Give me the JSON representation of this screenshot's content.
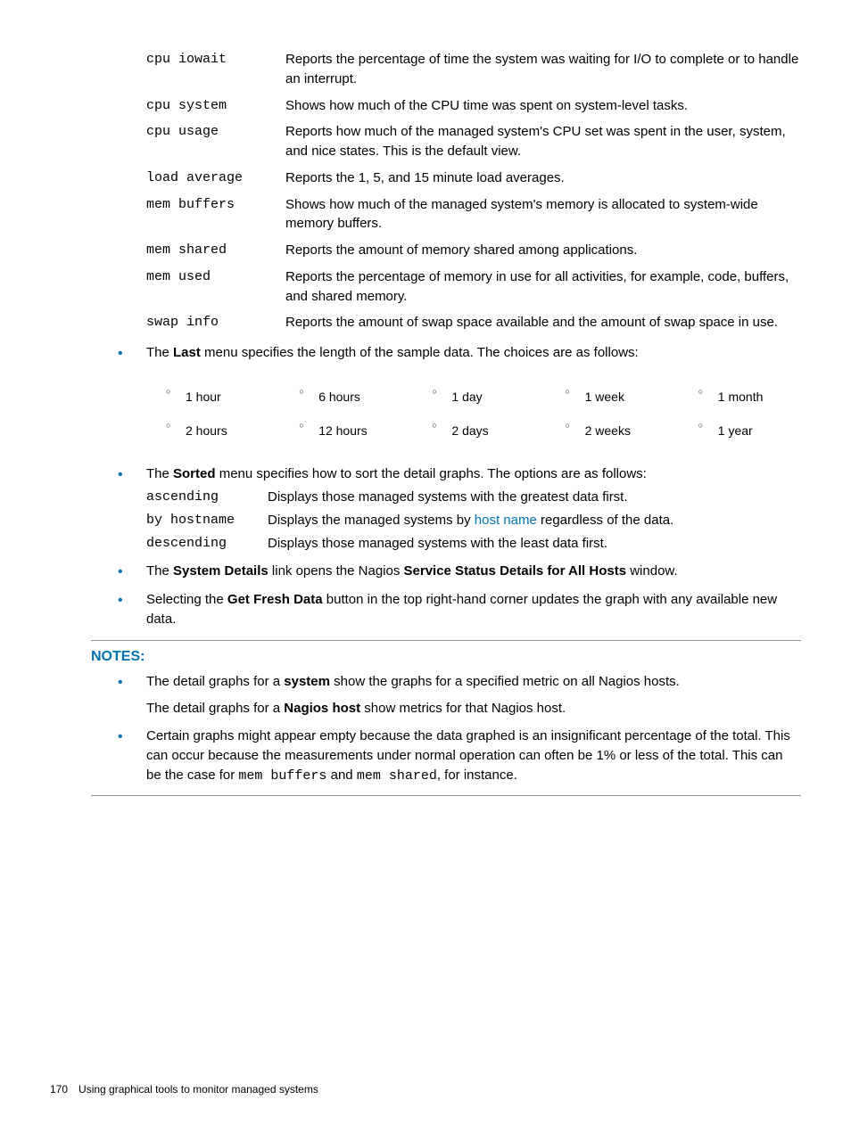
{
  "metrics": [
    {
      "term": "cpu iowait",
      "desc": "Reports the percentage of time the system was waiting for I/O to complete or to handle an interrupt."
    },
    {
      "term": "cpu system",
      "desc": "Shows how much of the CPU time was spent on system-level tasks."
    },
    {
      "term": "cpu usage",
      "desc": "Reports how much of the managed system's CPU set was spent in the user, system, and nice states. This is the default view."
    },
    {
      "term": "load average",
      "desc": "Reports the 1, 5, and 15 minute load averages."
    },
    {
      "term": "mem buffers",
      "desc": "Shows how much of the managed system's memory is allocated to system-wide memory buffers."
    },
    {
      "term": "mem shared",
      "desc": "Reports the amount of memory shared among applications."
    },
    {
      "term": "mem used",
      "desc": "Reports the percentage of memory in use for all activities, for example, code, buffers, and shared memory."
    },
    {
      "term": "swap info",
      "desc": "Reports the amount of swap space available and the amount of swap space in use."
    }
  ],
  "last_menu": {
    "intro_pre": "The ",
    "intro_bold": "Last",
    "intro_post": " menu specifies the length of the sample data. The choices are as follows:",
    "options": [
      "1 hour",
      "6 hours",
      "1 day",
      "1 week",
      "1 month",
      "2 hours",
      "12 hours",
      "2 days",
      "2 weeks",
      "1 year"
    ]
  },
  "sorted_menu": {
    "intro_pre": "The ",
    "intro_bold": "Sorted",
    "intro_post": " menu specifies how to sort the detail graphs. The options are as follows:",
    "rows": [
      {
        "term": "ascending",
        "desc_pre": "Displays those managed systems with the greatest data first.",
        "link": "",
        "desc_post": ""
      },
      {
        "term": "by hostname",
        "desc_pre": "Displays the managed systems by ",
        "link": "host name",
        "desc_post": " regardless of the data."
      },
      {
        "term": "descending",
        "desc_pre": "Displays those managed systems with the least data first.",
        "link": "",
        "desc_post": ""
      }
    ]
  },
  "system_details": {
    "pre": "The ",
    "b1": "System Details",
    "mid": " link opens the Nagios ",
    "b2": "Service Status Details for All Hosts",
    "post": " window."
  },
  "fresh_data": {
    "pre": "Selecting the ",
    "b1": "Get Fresh Data",
    "post": " button in the top right-hand corner updates the graph with any available new data."
  },
  "notes": {
    "heading": "NOTES:",
    "item1_line1_pre": "The detail graphs for a ",
    "item1_line1_b": "system",
    "item1_line1_post": " show the graphs for a specified metric on all Nagios hosts.",
    "item1_line2_pre": "The detail graphs for a ",
    "item1_line2_b": "Nagios host",
    "item1_line2_post": " show metrics for that Nagios host.",
    "item2_pre": "Certain graphs might appear empty because the data graphed is an insignificant percentage of the total. This can occur because the measurements under normal operation can often be 1% or less of the total. This can be the case for ",
    "item2_m1": "mem buffers",
    "item2_mid": " and ",
    "item2_m2": "mem shared",
    "item2_post": ", for instance."
  },
  "footer": {
    "page": "170",
    "title": "Using graphical tools to monitor managed systems"
  }
}
